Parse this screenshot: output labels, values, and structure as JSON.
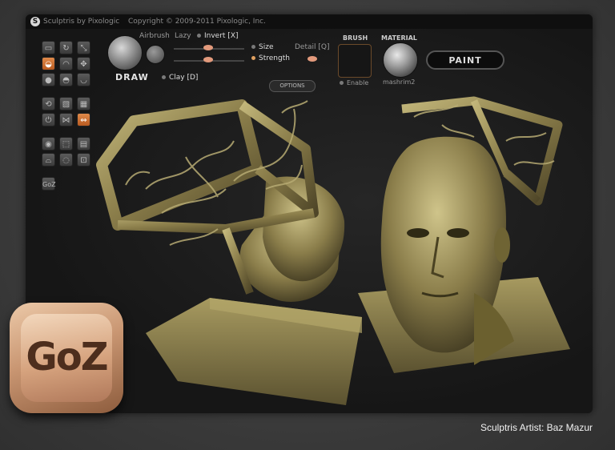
{
  "window": {
    "title": "Sculptris by Pixologic",
    "copyright": "Copyright © 2009-2011 Pixologic, Inc."
  },
  "toolbar": {
    "mode_label": "DRAW",
    "airbrush": "Airbrush",
    "lazy": "Lazy",
    "invert": "Invert [X]",
    "size": "Size",
    "strength": "Strength",
    "detail": "Detail [Q]",
    "options": "OPTIONS",
    "clay": "Clay [D]",
    "brush_label": "BRUSH",
    "enable": "Enable",
    "material_label": "MATERIAL",
    "material_name": "mashrim2",
    "paint_button": "PAINT"
  },
  "badge": {
    "goz": "GoZ"
  },
  "left_tools": [
    "GoZ"
  ],
  "footer": {
    "credit": "Sculptris Artist: Baz Mazur"
  },
  "colors": {
    "accent_orange": "#d97a3a",
    "sculpt_bronze": "#8a7d4a",
    "goz_badge": "#d6a37e"
  }
}
